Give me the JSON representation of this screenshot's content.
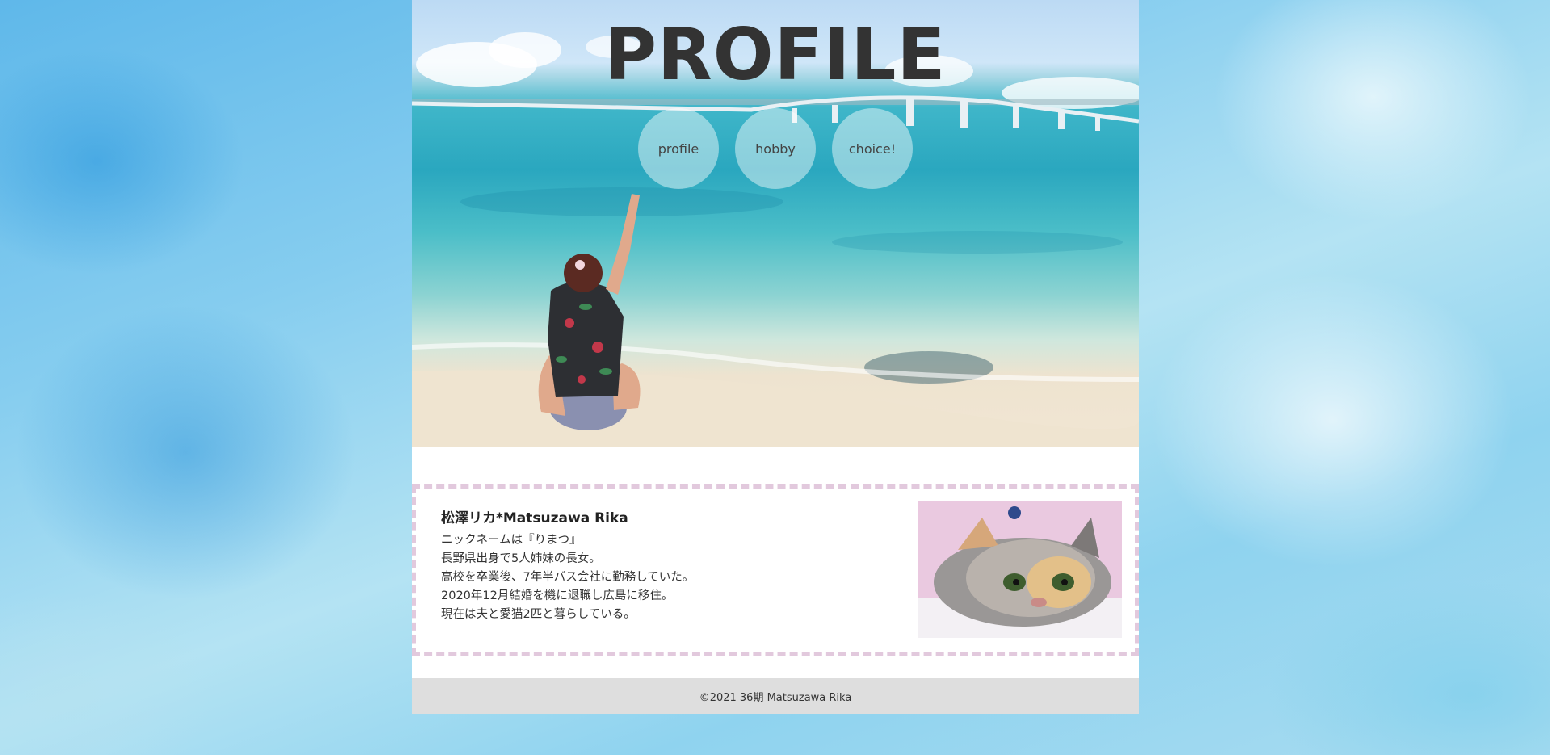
{
  "header": {
    "title": "PROFILE"
  },
  "nav": {
    "items": [
      {
        "label": "profile"
      },
      {
        "label": "hobby"
      },
      {
        "label": "choice!"
      }
    ]
  },
  "profile": {
    "name": "松澤リカ*Matsuzawa Rika",
    "lines": [
      "ニックネームは『りまつ』",
      "長野県出身で5人姉妹の長女。",
      "高校を卒業後、7年半バス会社に勤務していた。",
      "2020年12月結婚を機に退職し広島に移住。",
      "現在は夫と愛猫2匹と暮らしている。"
    ]
  },
  "footer": {
    "copyright": "©2021 36期 Matsuzawa Rika"
  },
  "colors": {
    "title": "#333333",
    "card_border": "#e2c9dd",
    "footer_bg": "#dedede"
  }
}
